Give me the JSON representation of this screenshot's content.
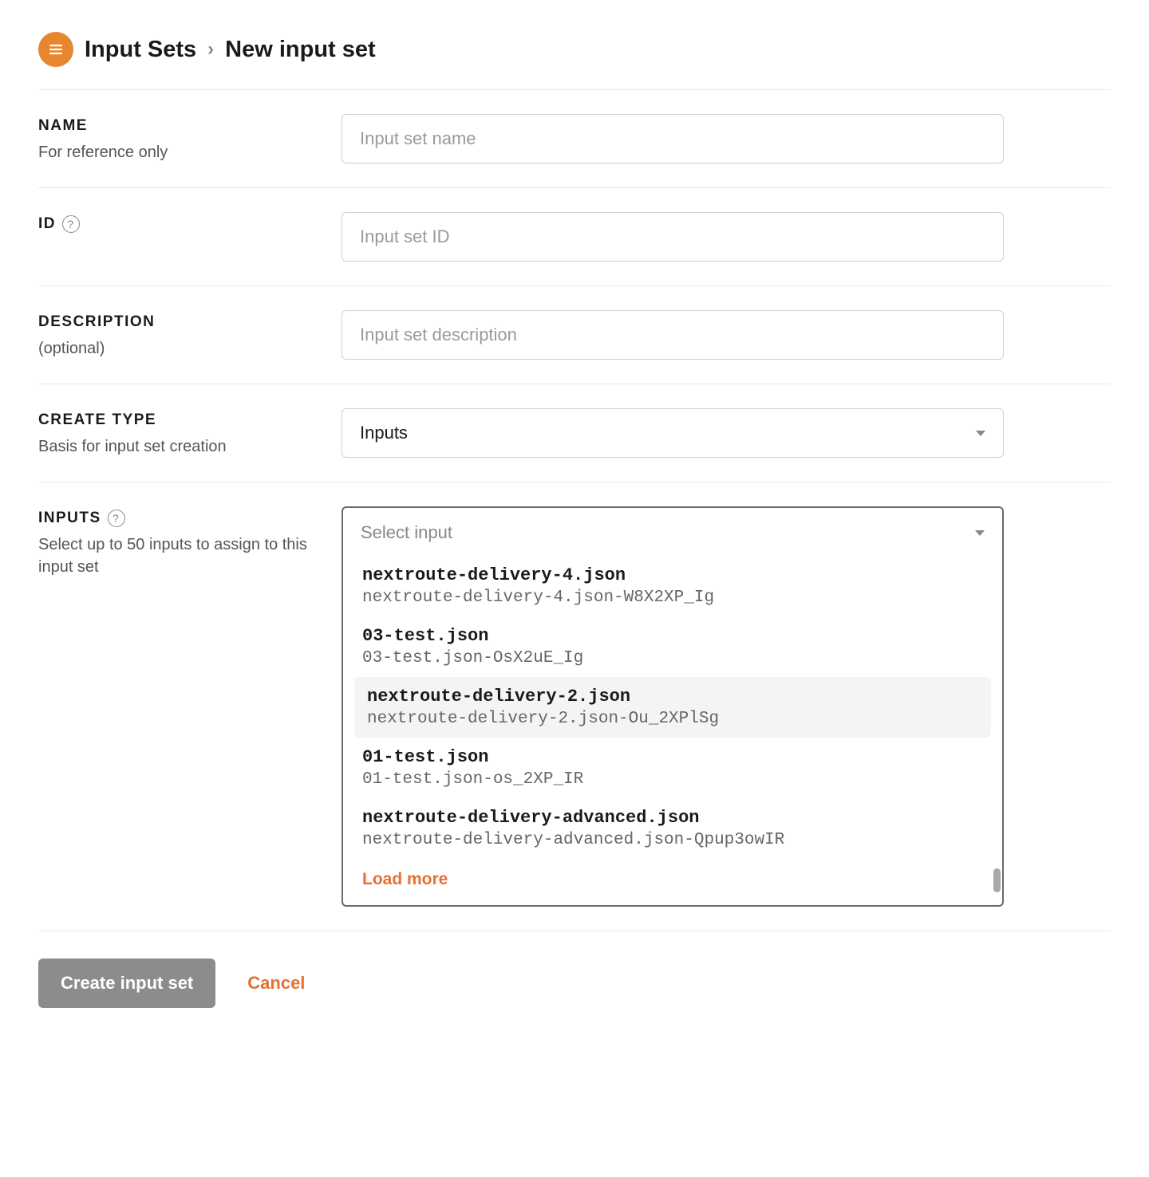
{
  "breadcrumb": {
    "parent": "Input Sets",
    "current": "New input set"
  },
  "fields": {
    "name": {
      "label": "NAME",
      "sub": "For reference only",
      "placeholder": "Input set name"
    },
    "id": {
      "label": "ID",
      "placeholder": "Input set ID"
    },
    "description": {
      "label": "DESCRIPTION",
      "sub": "(optional)",
      "placeholder": "Input set description"
    },
    "create_type": {
      "label": "CREATE TYPE",
      "sub": "Basis for input set creation",
      "value": "Inputs"
    },
    "inputs": {
      "label": "INPUTS",
      "sub": "Select up to 50 inputs to assign to this input set",
      "placeholder": "Select input",
      "options": [
        {
          "name": "nextroute-delivery-4.json",
          "id": "nextroute-delivery-4.json-W8X2XP_Ig"
        },
        {
          "name": "03-test.json",
          "id": "03-test.json-OsX2uE_Ig"
        },
        {
          "name": "nextroute-delivery-2.json",
          "id": "nextroute-delivery-2.json-Ou_2XPlSg"
        },
        {
          "name": "01-test.json",
          "id": "01-test.json-os_2XP_IR"
        },
        {
          "name": "nextroute-delivery-advanced.json",
          "id": "nextroute-delivery-advanced.json-Qpup3owIR"
        }
      ],
      "load_more": "Load more"
    }
  },
  "actions": {
    "submit": "Create input set",
    "cancel": "Cancel"
  }
}
